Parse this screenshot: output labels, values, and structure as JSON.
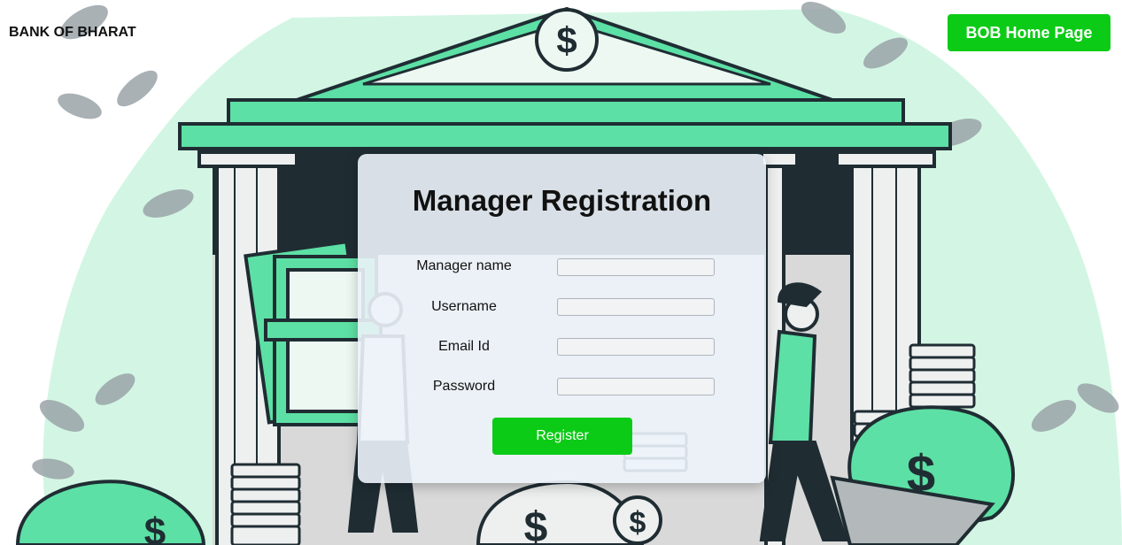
{
  "header": {
    "brand": "BANK OF BHARAT",
    "home_button": "BOB Home Page"
  },
  "form": {
    "title": "Manager Registration",
    "fields": [
      {
        "label": "Manager name",
        "value": ""
      },
      {
        "label": "Username",
        "value": ""
      },
      {
        "label": "Email Id",
        "value": ""
      },
      {
        "label": "Password",
        "value": ""
      }
    ],
    "submit_label": "Register"
  },
  "colors": {
    "accent": "#0ccb16",
    "illustration_green": "#5de0a5",
    "blob": "#d3f6e4",
    "dark": "#1f2d33"
  }
}
